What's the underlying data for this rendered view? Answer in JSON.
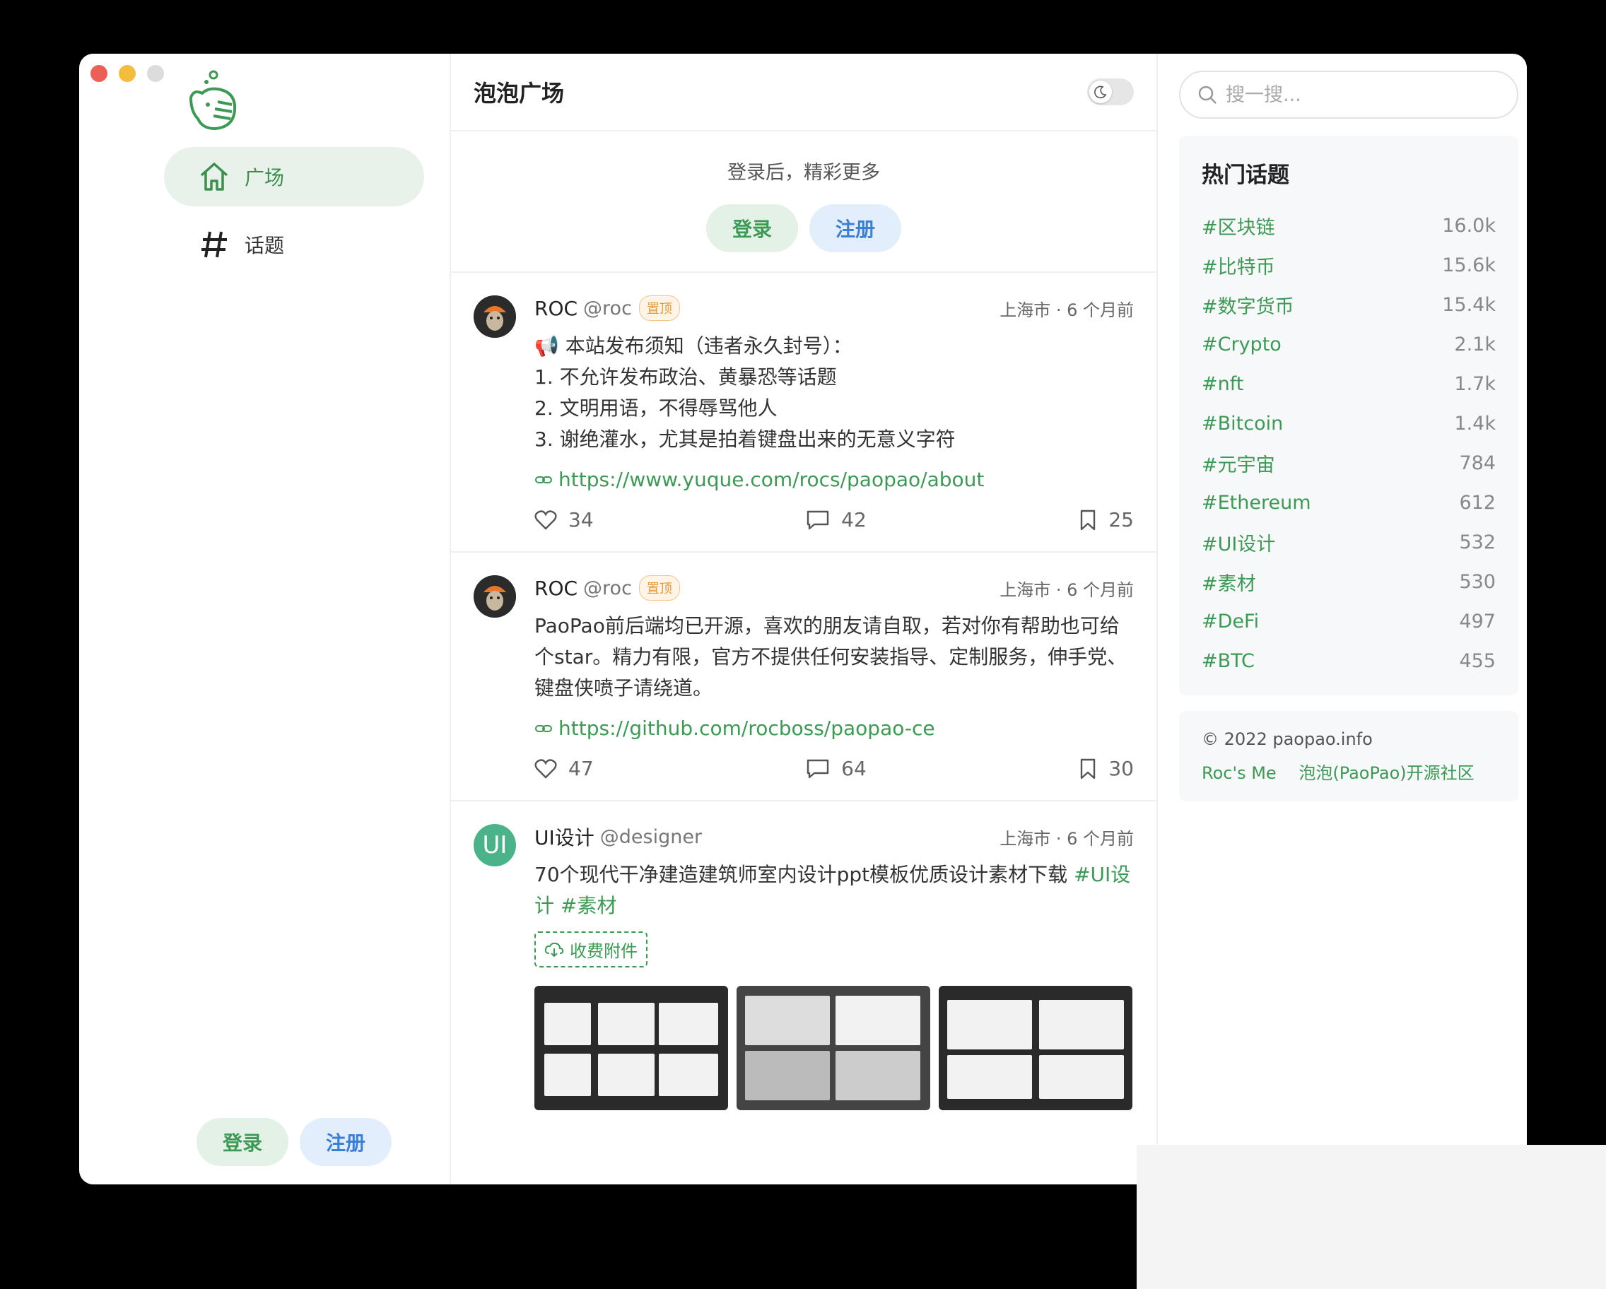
{
  "sidebar": {
    "nav": [
      {
        "label": "广场",
        "icon": "home-icon"
      },
      {
        "label": "话题",
        "icon": "hash-icon"
      }
    ],
    "login_label": "登录",
    "register_label": "注册"
  },
  "header": {
    "title": "泡泡广场"
  },
  "login_prompt": {
    "text": "登录后，精彩更多",
    "login_label": "登录",
    "register_label": "注册"
  },
  "posts": [
    {
      "name": "ROC",
      "handle": "@roc",
      "badge": "置顶",
      "meta": "上海市 · 6 个月前",
      "lines": [
        "📢 本站发布须知（违者永久封号）：",
        "1. 不允许发布政治、黄暴恐等话题",
        "2. 文明用语，不得辱骂他人",
        "3. 谢绝灌水，尤其是拍着键盘出来的无意义字符"
      ],
      "link": "https://www.yuque.com/rocs/paopao/about",
      "likes": "34",
      "comments": "42",
      "collections": "25"
    },
    {
      "name": "ROC",
      "handle": "@roc",
      "badge": "置顶",
      "meta": "上海市 · 6 个月前",
      "lines": [
        "PaoPao前后端均已开源，喜欢的朋友请自取，若对你有帮助也可给",
        "个star。精力有限，官方不提供任何安装指导、定制服务，伸手党、",
        "键盘侠喷子请绕道。"
      ],
      "link": "https://github.com/rocboss/paopao-ce",
      "likes": "47",
      "comments": "64",
      "collections": "30"
    },
    {
      "name": "UI设计",
      "handle": "@designer",
      "avatar_text": "UI",
      "meta": "上海市 · 6 个月前",
      "text": "70个现代干净建造建筑师室内设计ppt模板优质设计素材下载 ",
      "tag1": "#UI设计",
      "tag2": "#素材",
      "attachment": "收费附件"
    }
  ],
  "search": {
    "placeholder": "搜一搜..."
  },
  "hot_topics": {
    "title": "热门话题",
    "items": [
      {
        "name": "#区块链",
        "count": "16.0k"
      },
      {
        "name": "#比特币",
        "count": "15.6k"
      },
      {
        "name": "#数字货币",
        "count": "15.4k"
      },
      {
        "name": "#Crypto",
        "count": "2.1k"
      },
      {
        "name": "#nft",
        "count": "1.7k"
      },
      {
        "name": "#Bitcoin",
        "count": "1.4k"
      },
      {
        "name": "#元宇宙",
        "count": "784"
      },
      {
        "name": "#Ethereum",
        "count": "612"
      },
      {
        "name": "#UI设计",
        "count": "532"
      },
      {
        "name": "#素材",
        "count": "530"
      },
      {
        "name": "#DeFi",
        "count": "497"
      },
      {
        "name": "#BTC",
        "count": "455"
      }
    ]
  },
  "footer": {
    "copyright": "© 2022 paopao.info",
    "link1": "Roc's Me",
    "link2": "泡泡(PaoPao)开源社区"
  },
  "colors": {
    "accent": "#3c9a55",
    "blue": "#3a7fd8"
  }
}
